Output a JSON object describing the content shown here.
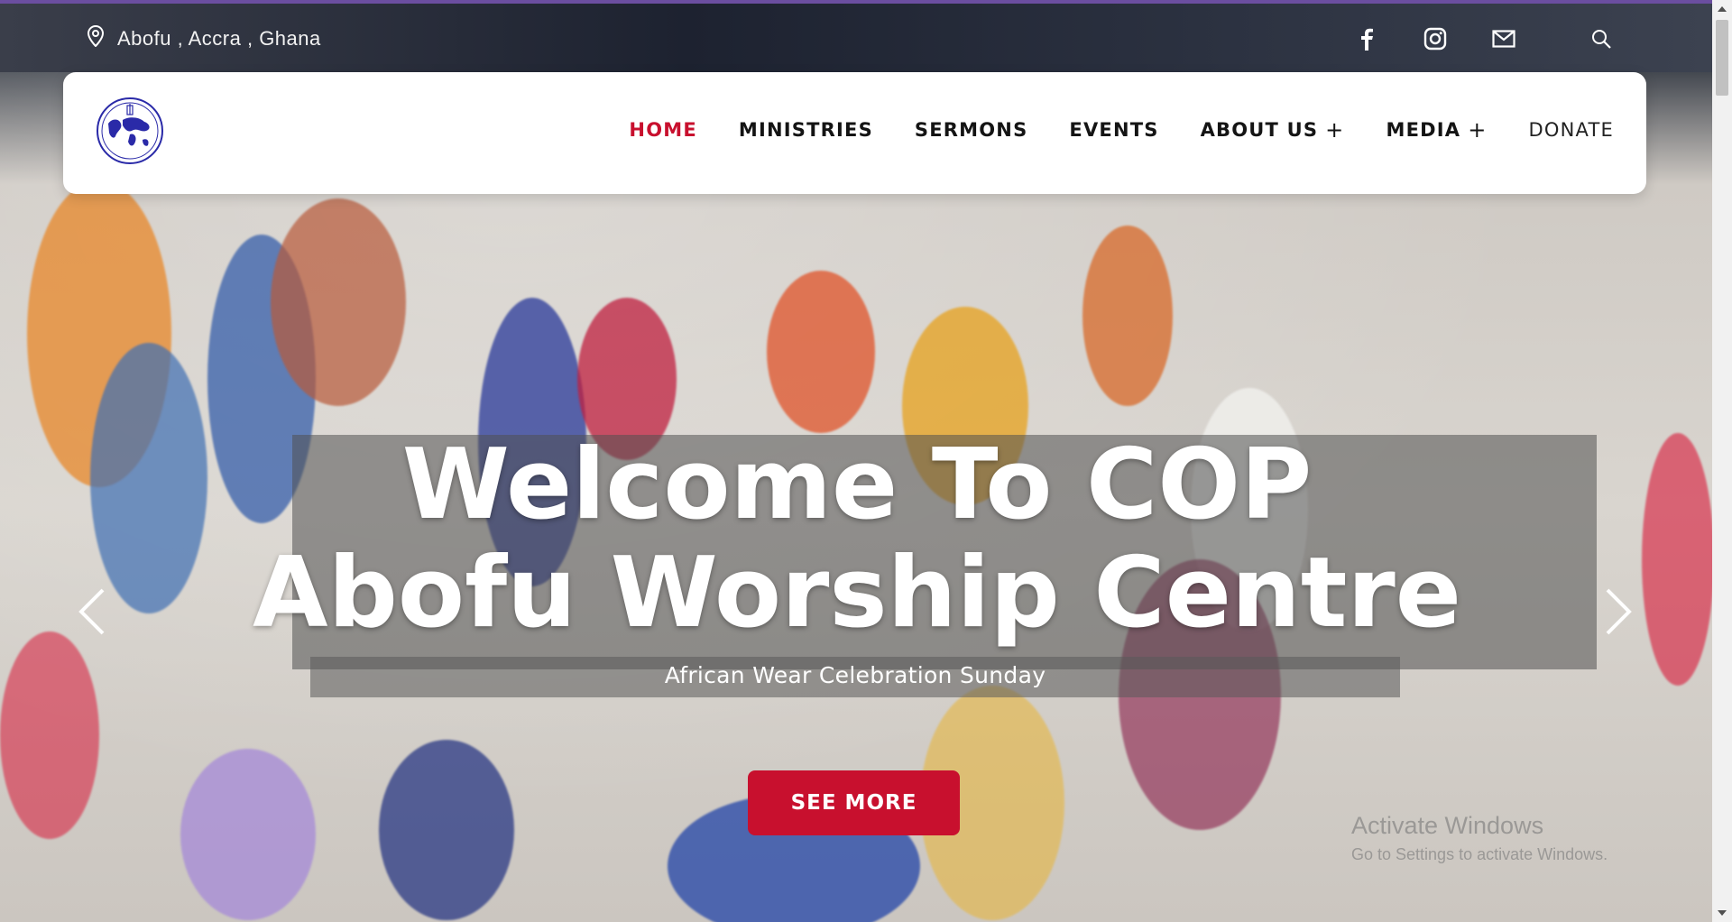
{
  "topbar": {
    "location_icon": "map-pin-icon",
    "location": "Abofu , Accra , Ghana",
    "social": [
      {
        "name": "facebook-icon"
      },
      {
        "name": "instagram-icon"
      },
      {
        "name": "email-icon"
      },
      {
        "name": "search-icon"
      }
    ]
  },
  "nav": {
    "items": [
      {
        "label": "HOME",
        "active": true
      },
      {
        "label": "MINISTRIES"
      },
      {
        "label": "SERMONS"
      },
      {
        "label": "EVENTS"
      },
      {
        "label": "ABOUT US",
        "plus": "+"
      },
      {
        "label": "MEDIA",
        "plus": "+"
      },
      {
        "label": "DONATE"
      }
    ]
  },
  "hero": {
    "title_line1": "Welcome To COP",
    "title_line2": "Abofu Worship Centre",
    "subtitle": "African Wear Celebration Sunday",
    "cta": "SEE MORE"
  },
  "watermark": {
    "line1": "Activate Windows",
    "line2": "Go to Settings to activate Windows."
  },
  "colors": {
    "accent": "#c8102e",
    "topline": "#6b4ea0"
  }
}
